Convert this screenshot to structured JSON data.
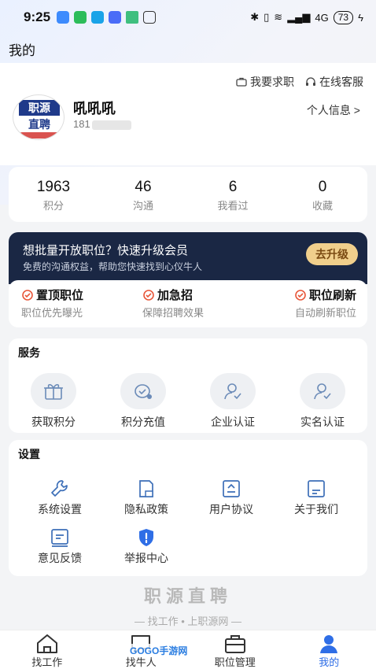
{
  "status_bar": {
    "time": "9:25",
    "network": "4G",
    "battery": "73"
  },
  "page_title": "我的",
  "header_links": {
    "job": "我要求职",
    "service": "在线客服"
  },
  "avatar": {
    "line1": "职源",
    "line2": "直聘"
  },
  "user": {
    "name": "吼吼吼",
    "phone_prefix": "181"
  },
  "personal_info": "个人信息 >",
  "stats": [
    {
      "value": "1963",
      "label": "积分"
    },
    {
      "value": "46",
      "label": "沟通"
    },
    {
      "value": "6",
      "label": "我看过"
    },
    {
      "value": "0",
      "label": "收藏"
    }
  ],
  "vip": {
    "title": "想批量开放职位？快速升级会员",
    "subtitle": "免费的沟通权益，帮助您快速找到心仪牛人",
    "button": "去升级"
  },
  "features": [
    {
      "title": "置顶职位",
      "desc": "职位优先曝光"
    },
    {
      "title": "加急招",
      "desc": "保障招聘效果"
    },
    {
      "title": "职位刷新",
      "desc": "自动刷新职位"
    }
  ],
  "services": {
    "title": "服务",
    "items": [
      {
        "label": "获取积分",
        "icon": "gift-icon"
      },
      {
        "label": "积分充值",
        "icon": "recharge-icon"
      },
      {
        "label": "企业认证",
        "icon": "enterprise-verify-icon"
      },
      {
        "label": "实名认证",
        "icon": "identity-verify-icon"
      }
    ]
  },
  "settings": {
    "title": "设置",
    "items": [
      {
        "label": "系统设置",
        "icon": "wrench-icon"
      },
      {
        "label": "隐私政策",
        "icon": "privacy-doc-icon"
      },
      {
        "label": "用户协议",
        "icon": "agreement-icon"
      },
      {
        "label": "关于我们",
        "icon": "about-doc-icon"
      },
      {
        "label": "意见反馈",
        "icon": "feedback-icon"
      },
      {
        "label": "举报中心",
        "icon": "report-shield-icon"
      }
    ]
  },
  "footer": {
    "brand": "职源直聘",
    "slogan": "— 找工作 • 上职源网 —"
  },
  "tabs": [
    {
      "label": "找工作",
      "icon": "home-icon",
      "active": false
    },
    {
      "label": "找牛人",
      "icon": "chat-icon",
      "active": false
    },
    {
      "label": "职位管理",
      "icon": "briefcase-icon",
      "active": false
    },
    {
      "label": "我的",
      "icon": "user-icon",
      "active": true
    }
  ],
  "watermark": "GOGO手游网",
  "colors": {
    "accent": "#2f6ee6",
    "vip_bg": "#1a2744",
    "vip_button": "#f0cf8c",
    "feature_icon": "#e8573a"
  }
}
